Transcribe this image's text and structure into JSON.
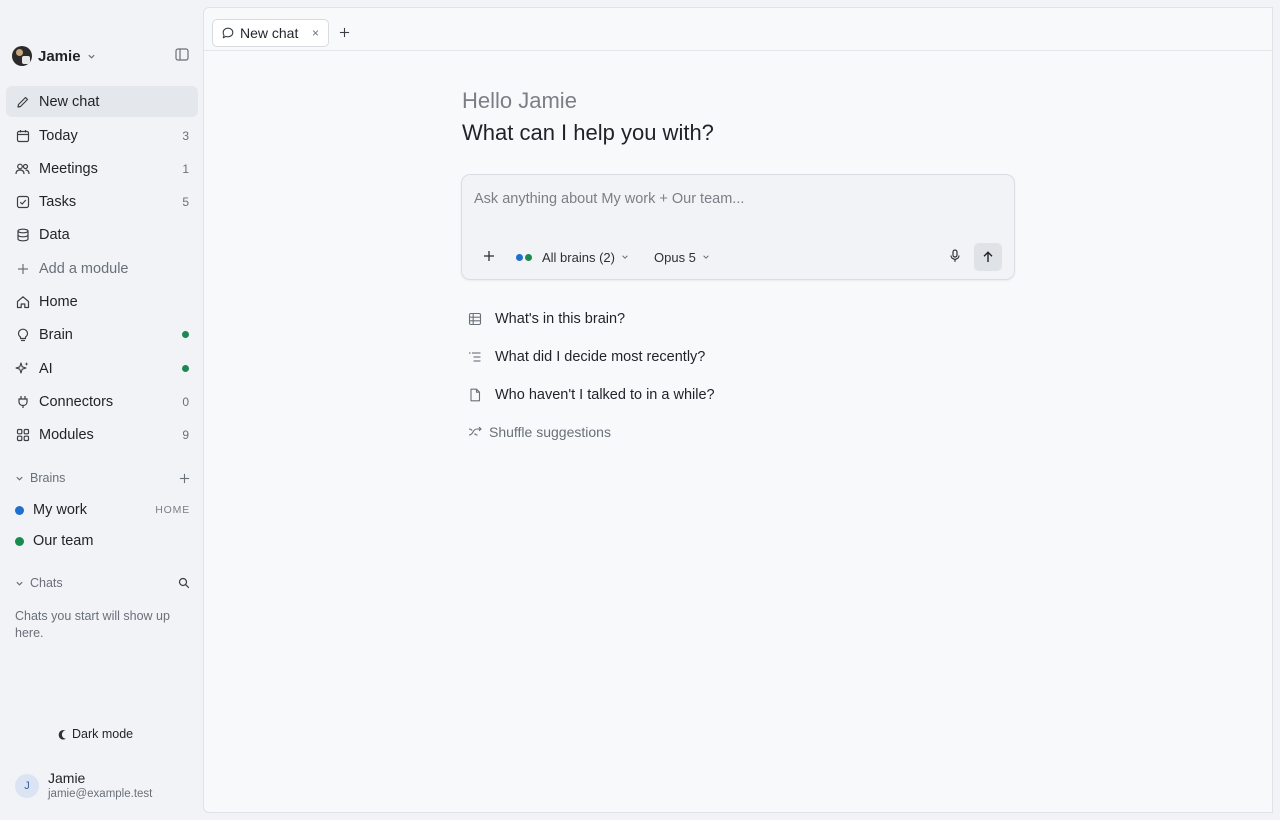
{
  "workspace": {
    "name": "Jamie"
  },
  "sidebar": {
    "items": [
      {
        "label": "New chat",
        "icon": "pencil-icon",
        "count": ""
      },
      {
        "label": "Today",
        "icon": "calendar-icon",
        "count": "3"
      },
      {
        "label": "Meetings",
        "icon": "people-icon",
        "count": "1"
      },
      {
        "label": "Tasks",
        "icon": "checkbox-icon",
        "count": "5"
      },
      {
        "label": "Data",
        "icon": "database-icon",
        "count": ""
      },
      {
        "label": "Add a module",
        "icon": "plus-icon",
        "count": ""
      },
      {
        "label": "Home",
        "icon": "home-icon",
        "count": ""
      },
      {
        "label": "Brain",
        "icon": "lightbulb-icon",
        "count": ""
      },
      {
        "label": "AI",
        "icon": "sparkle-icon",
        "count": ""
      },
      {
        "label": "Connectors",
        "icon": "plug-icon",
        "count": "0"
      },
      {
        "label": "Modules",
        "icon": "grid-icon",
        "count": "9"
      }
    ],
    "brains_heading": "Brains",
    "brains": [
      {
        "name": "My work",
        "tag": "HOME",
        "color": "#1f6fd1"
      },
      {
        "name": "Our team",
        "tag": "",
        "color": "#1a8a4f"
      }
    ],
    "chats_heading": "Chats",
    "chats_empty": "Chats you start will show up here.",
    "dark_mode_label": "Dark mode",
    "user": {
      "initial": "J",
      "name": "Jamie",
      "email": "jamie@example.test"
    }
  },
  "tabs": [
    {
      "label": "New chat",
      "close": "×"
    }
  ],
  "main": {
    "greeting": "Hello Jamie",
    "headline": "What can I help you with?",
    "composer": {
      "placeholder": "Ask anything about My work + Our team...",
      "brain_picker": "All brains (2)",
      "model_picker": "Opus 5"
    },
    "suggestions": [
      {
        "label": "What's in this brain?",
        "icon": "table-icon"
      },
      {
        "label": "What did I decide most recently?",
        "icon": "list-icon"
      },
      {
        "label": "Who haven't I talked to in a while?",
        "icon": "document-icon"
      }
    ],
    "shuffle_label": "Shuffle suggestions"
  },
  "colors": {
    "status_green": "#1a8a4f",
    "brain_blue": "#1f6fd1",
    "brain_green": "#1a8a4f"
  }
}
